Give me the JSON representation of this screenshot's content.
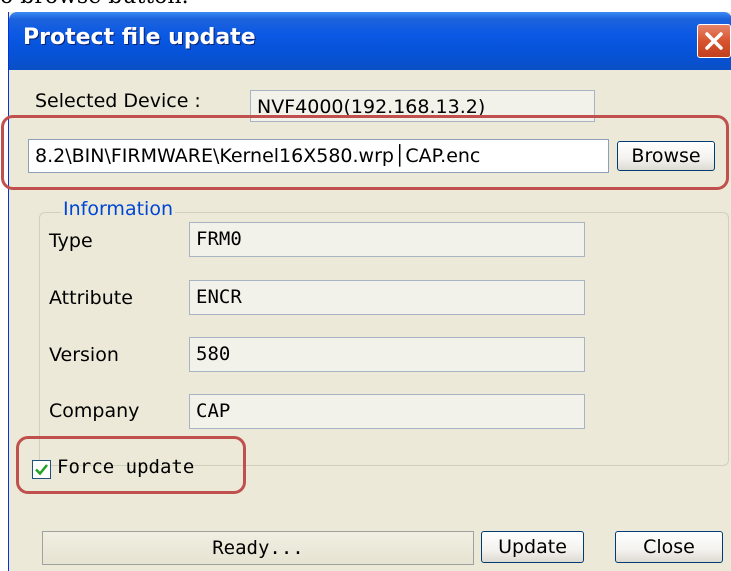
{
  "doc_caption": "o browse button.",
  "window": {
    "title": "Protect file update"
  },
  "device": {
    "label": "Selected Device :",
    "value": "NVF4000(192.168.13.2)"
  },
  "file": {
    "path": "8.2\\BIN\\FIRMWARE\\Kernel16X580.wrp│CAP.enc",
    "browse_label": "Browse"
  },
  "information": {
    "title": "Information",
    "fields": [
      {
        "label": "Type",
        "value": "FRM0"
      },
      {
        "label": "Attribute",
        "value": "ENCR"
      },
      {
        "label": "Version",
        "value": "580"
      },
      {
        "label": "Company",
        "value": "CAP"
      }
    ]
  },
  "force_update": {
    "label": "Force update",
    "checked": true
  },
  "status": {
    "text": "Ready..."
  },
  "buttons": {
    "update_label": "Update",
    "close_label": "Close"
  },
  "colors": {
    "title_bar": "#0a58e4",
    "annotation": "#c0504d",
    "group_title": "#0046d5",
    "window_bg": "#ece9d8"
  },
  "icons": {
    "close": "close-x-icon",
    "check": "checkmark-icon"
  }
}
